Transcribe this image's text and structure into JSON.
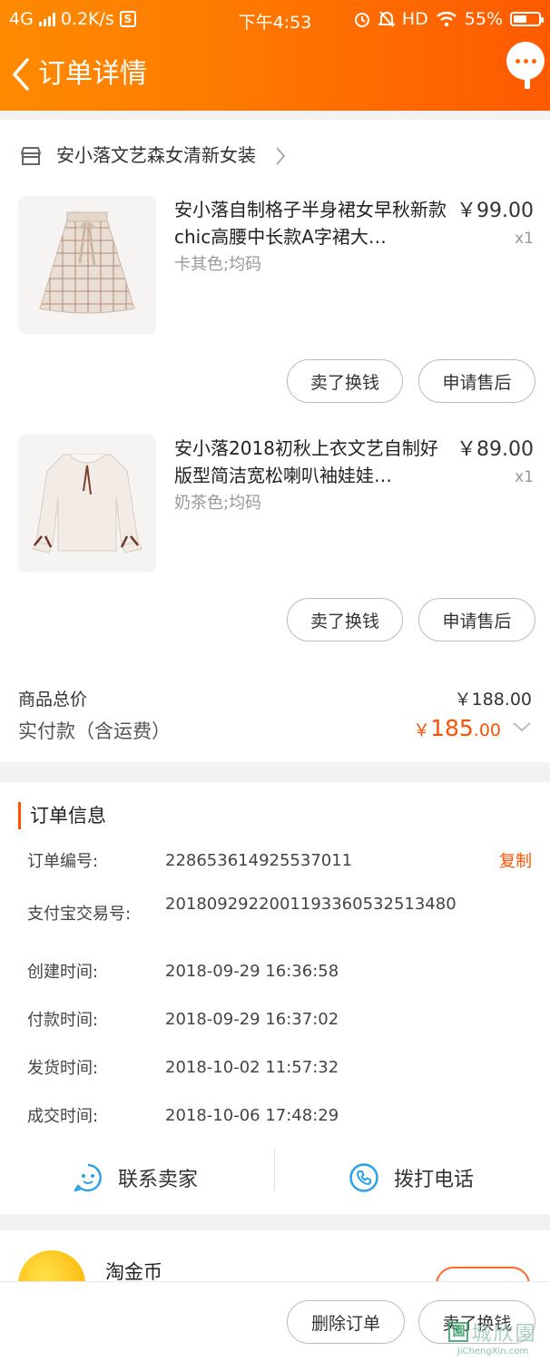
{
  "status_bar": {
    "network": "4G",
    "speed": "0.2K/s",
    "s_icon_text": "S",
    "time": "下午4:53",
    "hd": "HD",
    "battery_percent": "55%",
    "battery_level": 0.55
  },
  "nav": {
    "title": "订单详情"
  },
  "shop": {
    "name": "安小落文艺森女清新女装"
  },
  "items": [
    {
      "title": "安小落自制格子半身裙女早秋新款chic高腰中长款A字裙大…",
      "sku": "卡其色;均码",
      "price": "￥99.00",
      "qty": "x1",
      "sell_label": "卖了换钱",
      "after_sale_label": "申请售后",
      "image": "plaid-skirt"
    },
    {
      "title": "安小落2018初秋上衣文艺自制好版型简洁宽松喇叭袖娃娃…",
      "sku": "奶茶色;均码",
      "price": "￥89.00",
      "qty": "x1",
      "sell_label": "卖了换钱",
      "after_sale_label": "申请售后",
      "image": "blouse"
    }
  ],
  "totals": {
    "goods_total_label": "商品总价",
    "goods_total_value": "￥188.00",
    "paid_label": "实付款（含运费）",
    "paid_symbol": "￥",
    "paid_int": "185",
    "paid_dec": ".00"
  },
  "order_info": {
    "title": "订单信息",
    "copy_label": "复制",
    "rows": [
      {
        "label": "订单编号:",
        "value": "228653614925537011"
      },
      {
        "label": "支付宝交易号:",
        "value": "2018092922001193360532513480"
      },
      {
        "label": "创建时间:",
        "value": "2018-09-29 16:36:58"
      },
      {
        "label": "付款时间:",
        "value": "2018-09-29 16:37:02"
      },
      {
        "label": "发货时间:",
        "value": "2018-10-02 11:57:32"
      },
      {
        "label": "成交时间:",
        "value": "2018-10-06 17:48:29"
      }
    ]
  },
  "contact": {
    "seller_label": "联系卖家",
    "phone_label": "拨打电话"
  },
  "coin": {
    "title": "淘金币"
  },
  "bottom": {
    "delete_label": "删除订单",
    "sell_label": "卖了换钱"
  },
  "watermark": {
    "box": "園",
    "cn": "城欣園",
    "url": "JiChengXin.com"
  },
  "colors": {
    "accent": "#ff5000",
    "header_start": "#ff8a00",
    "header_end": "#ff5a00",
    "contact_icon": "#2aa2e8"
  }
}
